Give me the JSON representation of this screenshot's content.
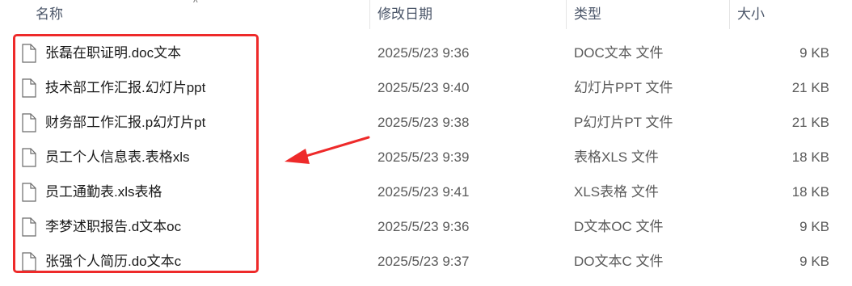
{
  "columns": {
    "name": "名称",
    "modified": "修改日期",
    "type": "类型",
    "size": "大小"
  },
  "sort_indicator": "^",
  "files": [
    {
      "name": "张磊在职证明.doc文本",
      "modified": "2025/5/23 9:36",
      "type": "DOC文本 文件",
      "size": "9 KB"
    },
    {
      "name": "技术部工作汇报.幻灯片ppt",
      "modified": "2025/5/23 9:40",
      "type": "幻灯片PPT 文件",
      "size": "21 KB"
    },
    {
      "name": "财务部工作汇报.p幻灯片pt",
      "modified": "2025/5/23 9:38",
      "type": "P幻灯片PT 文件",
      "size": "21 KB"
    },
    {
      "name": "员工个人信息表.表格xls",
      "modified": "2025/5/23 9:39",
      "type": "表格XLS 文件",
      "size": "18 KB"
    },
    {
      "name": "员工通勤表.xls表格",
      "modified": "2025/5/23 9:41",
      "type": "XLS表格 文件",
      "size": "18 KB"
    },
    {
      "name": "李梦述职报告.d文本oc",
      "modified": "2025/5/23 9:36",
      "type": "D文本OC 文件",
      "size": "9 KB"
    },
    {
      "name": "张强个人简历.do文本c",
      "modified": "2025/5/23 9:37",
      "type": "DO文本C 文件",
      "size": "9 KB"
    }
  ],
  "colors": {
    "highlight": "#ee2a2a",
    "arrow": "#ee2a2a",
    "header_text": "#4a5568"
  },
  "icons": {
    "file": "file-icon",
    "arrow": "red-arrow-annotation"
  }
}
